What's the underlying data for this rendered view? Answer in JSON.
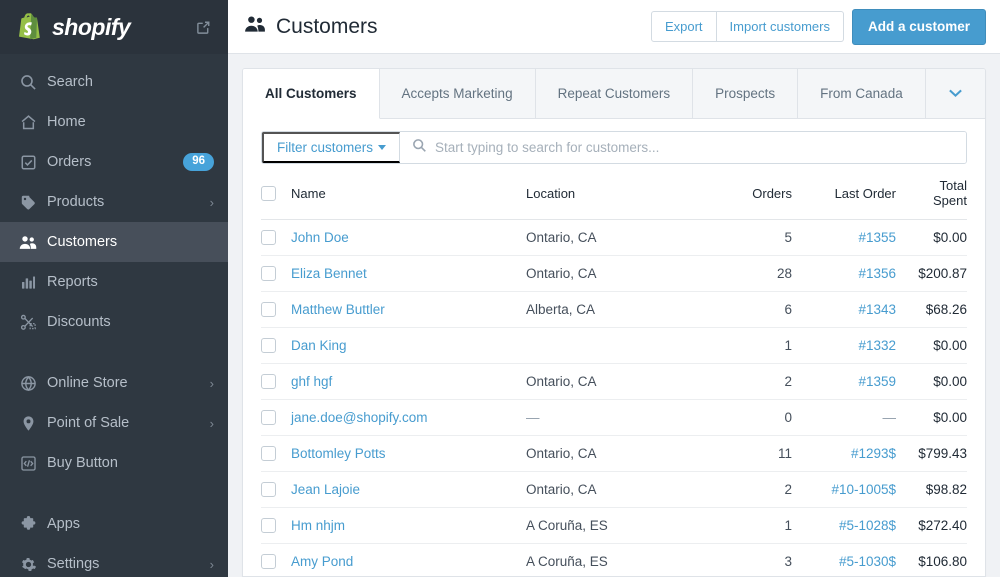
{
  "sidebar": {
    "brand": {
      "name": "shopify",
      "logo_icon": "shopify-bag-icon",
      "external_link_icon": "external-link-icon"
    },
    "items": [
      {
        "id": "search",
        "label": "Search",
        "icon": "search-icon",
        "badge": null,
        "chevron": false,
        "active": false,
        "gap_after": false
      },
      {
        "id": "home",
        "label": "Home",
        "icon": "home-icon",
        "badge": null,
        "chevron": false,
        "active": false,
        "gap_after": false
      },
      {
        "id": "orders",
        "label": "Orders",
        "icon": "orders-icon",
        "badge": "96",
        "chevron": false,
        "active": false,
        "gap_after": false
      },
      {
        "id": "products",
        "label": "Products",
        "icon": "tag-icon",
        "badge": null,
        "chevron": true,
        "active": false,
        "gap_after": false
      },
      {
        "id": "customers",
        "label": "Customers",
        "icon": "customers-icon",
        "badge": null,
        "chevron": false,
        "active": true,
        "gap_after": false
      },
      {
        "id": "reports",
        "label": "Reports",
        "icon": "reports-icon",
        "badge": null,
        "chevron": false,
        "active": false,
        "gap_after": false
      },
      {
        "id": "discounts",
        "label": "Discounts",
        "icon": "discount-icon",
        "badge": null,
        "chevron": false,
        "active": false,
        "gap_after": true
      },
      {
        "id": "online-store",
        "label": "Online Store",
        "icon": "globe-icon",
        "badge": null,
        "chevron": true,
        "active": false,
        "gap_after": false
      },
      {
        "id": "point-of-sale",
        "label": "Point of Sale",
        "icon": "location-pin-icon",
        "badge": null,
        "chevron": true,
        "active": false,
        "gap_after": false
      },
      {
        "id": "buy-button",
        "label": "Buy Button",
        "icon": "code-icon",
        "badge": null,
        "chevron": false,
        "active": false,
        "gap_after": true
      },
      {
        "id": "apps",
        "label": "Apps",
        "icon": "puzzle-icon",
        "badge": null,
        "chevron": false,
        "active": false,
        "gap_after": false
      },
      {
        "id": "settings",
        "label": "Settings",
        "icon": "gear-icon",
        "badge": null,
        "chevron": true,
        "active": false,
        "gap_after": false
      }
    ]
  },
  "header": {
    "title": "Customers",
    "title_icon": "customers-icon",
    "export_label": "Export",
    "import_label": "Import customers",
    "add_label": "Add a customer"
  },
  "tabs": [
    {
      "label": "All Customers",
      "active": true
    },
    {
      "label": "Accepts Marketing",
      "active": false
    },
    {
      "label": "Repeat Customers",
      "active": false
    },
    {
      "label": "Prospects",
      "active": false
    },
    {
      "label": "From Canada",
      "active": false
    }
  ],
  "tabs_more_icon": "chevron-down-icon",
  "filter": {
    "button_label": "Filter customers",
    "caret_icon": "caret-down-icon",
    "search_icon": "search-icon",
    "search_value": "",
    "search_placeholder": "Start typing to search for customers..."
  },
  "table": {
    "columns": [
      "Name",
      "Location",
      "Orders",
      "Last Order",
      "Total Spent"
    ],
    "select_all_name": "select-all-checkbox",
    "rows": [
      {
        "name": "John Doe",
        "location": "Ontario, CA",
        "orders": "5",
        "last_order": "#1355",
        "total": "$0.00"
      },
      {
        "name": "Eliza Bennet",
        "location": "Ontario, CA",
        "orders": "28",
        "last_order": "#1356",
        "total": "$200.87"
      },
      {
        "name": "Matthew Buttler",
        "location": "Alberta, CA",
        "orders": "6",
        "last_order": "#1343",
        "total": "$68.26"
      },
      {
        "name": "Dan King",
        "location": "",
        "orders": "1",
        "last_order": "#1332",
        "total": "$0.00"
      },
      {
        "name": "ghf hgf",
        "location": "Ontario, CA",
        "orders": "2",
        "last_order": "#1359",
        "total": "$0.00"
      },
      {
        "name": "jane.doe@shopify.com",
        "location": "—",
        "orders": "0",
        "last_order": "—",
        "total": "$0.00"
      },
      {
        "name": "Bottomley Potts",
        "location": "Ontario, CA",
        "orders": "11",
        "last_order": "#1293$",
        "total": "$799.43"
      },
      {
        "name": "Jean Lajoie",
        "location": "Ontario, CA",
        "orders": "2",
        "last_order": "#10-1005$",
        "total": "$98.82"
      },
      {
        "name": "Hm nhjm",
        "location": "A Coruña, ES",
        "orders": "1",
        "last_order": "#5-1028$",
        "total": "$272.40"
      },
      {
        "name": "Amy Pond",
        "location": "A Coruña, ES",
        "orders": "3",
        "last_order": "#5-1030$",
        "total": "$106.80"
      }
    ]
  },
  "colors": {
    "sidebar_bg": "#2f3841",
    "sidebar_active": "#474f5a",
    "accent_blue": "#479ccf",
    "badge_blue": "#47a3da",
    "logo_green": "#95bf47",
    "page_bg": "#f0f2f5",
    "border": "#dfe3e8"
  }
}
